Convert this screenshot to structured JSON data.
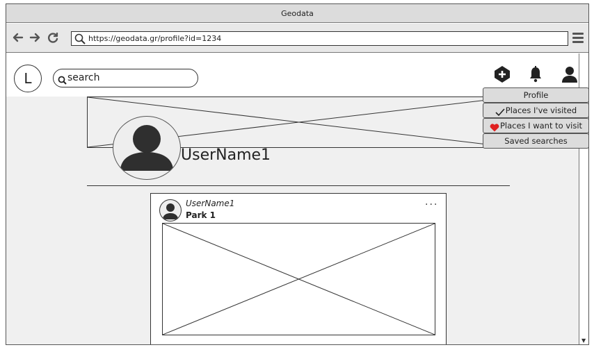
{
  "window": {
    "title": "Geodata"
  },
  "browser": {
    "url": "https://geodata.gr/profile?id=1234",
    "back_icon": "back-arrow-icon",
    "forward_icon": "forward-arrow-icon",
    "reload_icon": "reload-icon"
  },
  "header": {
    "logo_letter": "L",
    "search_text": "search",
    "icons": [
      "add-icon",
      "bell-icon",
      "user-icon"
    ]
  },
  "profile": {
    "username": "UserName1"
  },
  "post": {
    "user": "UserName1",
    "place": "Park 1",
    "more": "..."
  },
  "dropdown": {
    "items": [
      {
        "label": "Profile",
        "icon": ""
      },
      {
        "label": "Places I've visited",
        "icon": "check-icon"
      },
      {
        "label": "Places I want to visit",
        "icon": "heart-icon"
      },
      {
        "label": "Saved searches",
        "icon": ""
      }
    ]
  },
  "colors": {
    "heart": "#e02020",
    "panel": "#dcdcdc",
    "page_bg": "#f0f0f0"
  }
}
